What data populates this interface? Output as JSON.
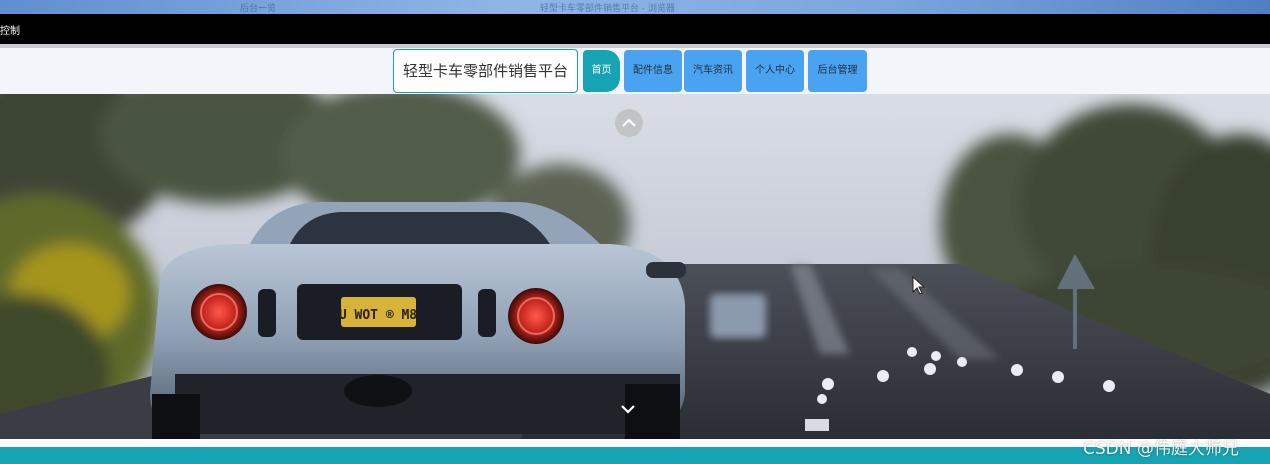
{
  "os_titlebar": {
    "left_text": "后台一览",
    "center_text": "轻型卡车零部件销售平台 - 浏览器"
  },
  "top_strip": {
    "text": "控制"
  },
  "header": {
    "site_title": "轻型卡车零部件销售平台",
    "nav_items": [
      {
        "label": "首页"
      },
      {
        "label": "配件信息"
      },
      {
        "label": "汽车资讯"
      },
      {
        "label": "个人中心"
      },
      {
        "label": "后台管理"
      }
    ]
  },
  "hero": {
    "license_plate": "U WOT ® M8",
    "carousel_up_icon": "chevron-up-icon",
    "carousel_down_icon": "chevron-down-icon"
  },
  "watermark": {
    "text": "CSDN @伟庭大师兄"
  },
  "colors": {
    "accent_teal": "#16a3b3",
    "nav_blue": "#4aa3f0",
    "nav_bg": "#f3f5fb"
  }
}
